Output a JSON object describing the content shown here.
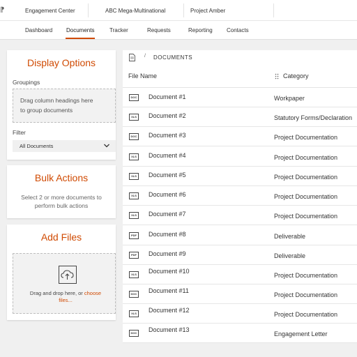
{
  "header": {
    "logo_glyph": "⁋",
    "breadcrumbs": [
      "Engagement Center",
      "ABC Mega-Multinational",
      "Project Amber"
    ]
  },
  "nav": {
    "tabs": [
      "Dashboard",
      "Documents",
      "Tracker",
      "Requests",
      "Reporting",
      "Contacts"
    ],
    "active": "Documents"
  },
  "display_options": {
    "title": "Display Options",
    "groupings_label": "Groupings",
    "groupings_hint_line1": "Drag column headings here",
    "groupings_hint_line2": "to group documents",
    "filter_label": "Filter",
    "filter_value": "All Documents"
  },
  "bulk_actions": {
    "title": "Bulk Actions",
    "hint_line1": "Select 2 or more documents to",
    "hint_line2": "perform bulk actions"
  },
  "add_files": {
    "title": "Add Files",
    "hint_prefix": "Drag and drop here, or",
    "hint_link_part1": "choose",
    "hint_link_part2": "files..."
  },
  "documents": {
    "breadcrumb_slash": "/",
    "breadcrumb": "DOCUMENTS",
    "columns": {
      "file_name": "File Name",
      "category": "Category"
    },
    "rows": [
      {
        "type": "DOC",
        "name": "Document #1",
        "category": "Workpaper"
      },
      {
        "type": "XLS",
        "name": "Document #2",
        "category": "Statutory Forms/Declaration"
      },
      {
        "type": "DOC",
        "name": "Document #3",
        "category": "Project Documentation"
      },
      {
        "type": "XLS",
        "name": "Document #4",
        "category": "Project Documentation"
      },
      {
        "type": "XLS",
        "name": "Document #5",
        "category": "Project Documentation"
      },
      {
        "type": "XLS",
        "name": "Document #6",
        "category": "Project Documentation"
      },
      {
        "type": "XLS",
        "name": "Document #7",
        "category": "Project Documentation"
      },
      {
        "type": "PDF",
        "name": "Document #8",
        "category": "Deliverable"
      },
      {
        "type": "PDF",
        "name": "Document #9",
        "category": "Deliverable"
      },
      {
        "type": "XLS",
        "name": "Document #10",
        "category": "Project Documentation"
      },
      {
        "type": "DOC",
        "name": "Document #11",
        "category": "Project Documentation"
      },
      {
        "type": "XLS",
        "name": "Document #12",
        "category": "Project Documentation"
      },
      {
        "type": "DOC",
        "name": "Document #13",
        "category": "Engagement Letter"
      }
    ]
  },
  "colors": {
    "accent": "#d04a02"
  }
}
